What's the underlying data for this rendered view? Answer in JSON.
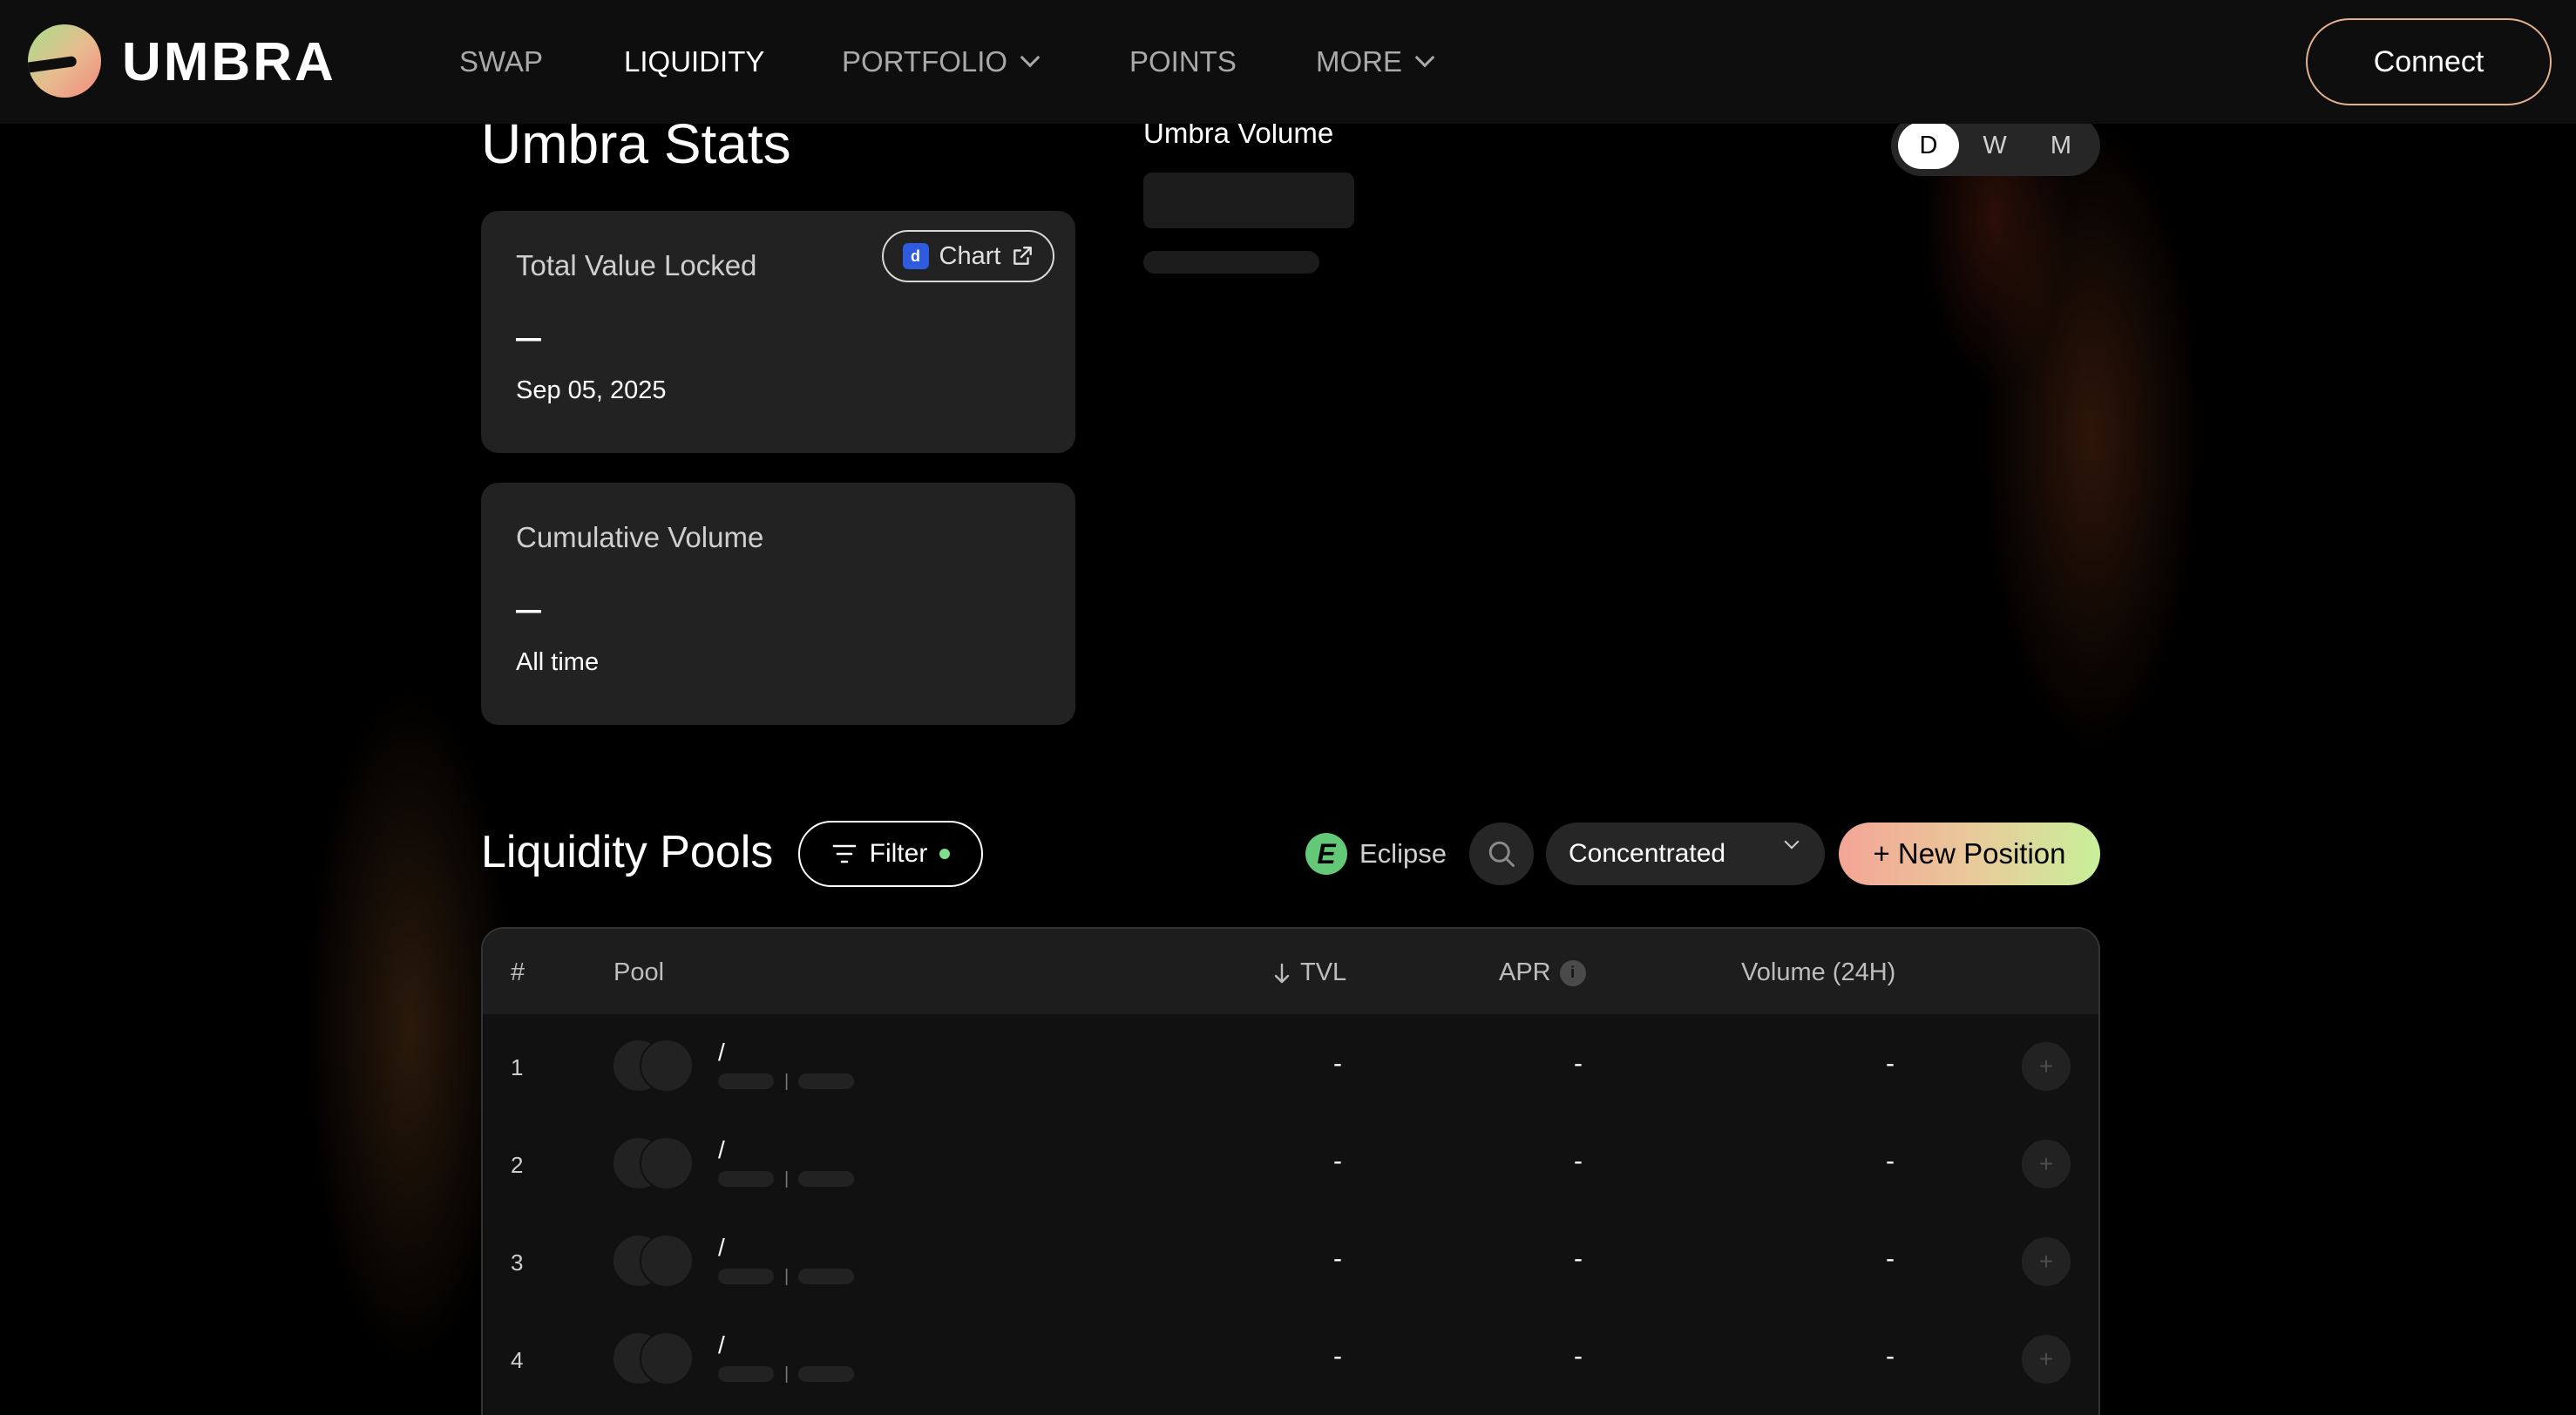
{
  "nav": {
    "brand": "UMBRA",
    "items": [
      "SWAP",
      "LIQUIDITY",
      "PORTFOLIO",
      "POINTS",
      "MORE"
    ],
    "active": "LIQUIDITY",
    "connect_label": "Connect"
  },
  "stats": {
    "title": "Umbra Stats",
    "tvl": {
      "label": "Total Value Locked",
      "value": "–",
      "sub": "Sep 05, 2025",
      "chart_label": "Chart"
    },
    "volume": {
      "label": "Cumulative Volume",
      "value": "–",
      "sub": "All time"
    },
    "volume_chart_title": "Umbra Volume",
    "ranges": [
      "D",
      "W",
      "M"
    ],
    "range_selected": "D"
  },
  "pools": {
    "title": "Liquidity Pools",
    "filter_label": "Filter",
    "network": "Eclipse",
    "type_selected": "Concentrated",
    "new_position_label": "+ New Position",
    "columns": {
      "num": "#",
      "pool": "Pool",
      "tvl": "TVL",
      "apr": "APR",
      "volume": "Volume (24H)"
    },
    "rows": [
      {
        "num": "1",
        "pair": "/",
        "tvl": "-",
        "apr": "-",
        "volume": "-"
      },
      {
        "num": "2",
        "pair": "/",
        "tvl": "-",
        "apr": "-",
        "volume": "-"
      },
      {
        "num": "3",
        "pair": "/",
        "tvl": "-",
        "apr": "-",
        "volume": "-"
      },
      {
        "num": "4",
        "pair": "/",
        "tvl": "-",
        "apr": "-",
        "volume": "-"
      }
    ]
  },
  "icons": [
    "logo-icon",
    "chevron-down-icon",
    "chart-provider-icon",
    "external-link-icon",
    "filter-icon",
    "eclipse-icon",
    "search-icon",
    "arrow-down-icon",
    "info-icon",
    "plus-icon"
  ],
  "colors": {
    "background": "#000000",
    "card": "#222222",
    "accent_green": "#7dde8b",
    "brand_gradient_start": "#f4a596",
    "brand_gradient_end": "#c8f09a"
  }
}
